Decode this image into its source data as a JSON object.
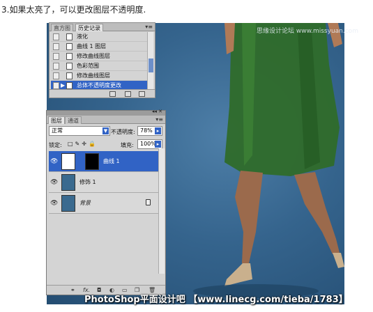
{
  "caption": "3.如果太亮了，可以更改图层不透明度.",
  "watermark_top": "思缘设计论坛 www.missyuan.com",
  "watermark_bottom": "PhotoShop平面设计吧 【www.linecg.com/tieba/1783】",
  "history": {
    "tabs": [
      "直方图",
      "历史记录"
    ],
    "items": [
      "液化",
      "曲线 1 图层",
      "修改曲线图层",
      "色彩范围",
      "修改曲线图层",
      "总体不透明度更改"
    ],
    "selected_index": 5
  },
  "layers": {
    "tabs": [
      "图层",
      "通道"
    ],
    "blend_mode": "正常",
    "opacity_label": "不透明度:",
    "opacity_value": "78%",
    "lock_label": "锁定:",
    "fill_label": "填充:",
    "fill_value": "100%",
    "items": [
      {
        "name": "曲线 1",
        "selected": true
      },
      {
        "name": "修饰 1",
        "selected": false
      },
      {
        "name": "背景",
        "selected": false
      }
    ],
    "footer_icons": [
      "link-icon",
      "fx-icon",
      "mask-icon",
      "adjustment-icon",
      "group-icon",
      "new-layer-icon",
      "trash-icon"
    ]
  }
}
